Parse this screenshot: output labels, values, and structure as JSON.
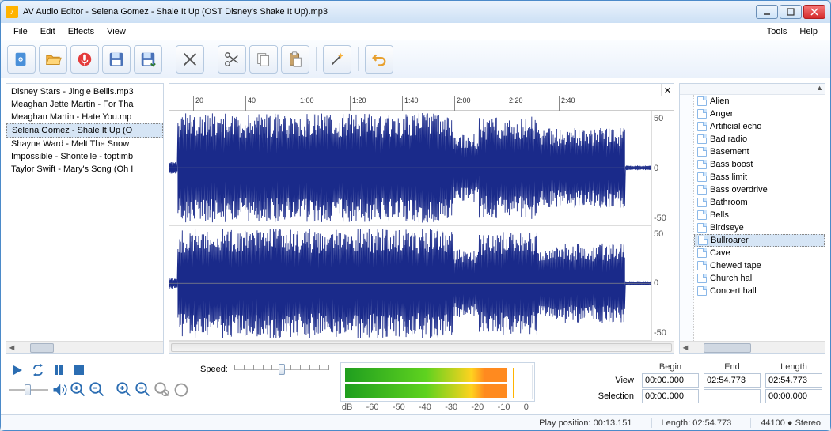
{
  "title": "AV Audio Editor - Selena Gomez - Shale It Up (OST Disney's Shake It Up).mp3",
  "menu": {
    "file": "File",
    "edit": "Edit",
    "effects": "Effects",
    "view": "View",
    "tools": "Tools",
    "help": "Help"
  },
  "toolbar_icons": [
    "new-file",
    "open-folder",
    "record",
    "save",
    "save-as",
    "cut",
    "scissors",
    "copy",
    "paste",
    "wand",
    "undo"
  ],
  "playlist": {
    "items": [
      "Disney Stars - Jingle Bellls.mp3",
      "Meaghan Jette Martin - For Tha",
      "Meaghan Martin - Hate You.mp",
      "Selena Gomez - Shale It Up (O",
      "Shayne Ward - Melt The Snow",
      "Impossible - Shontelle - toptimb",
      "Taylor Swift - Mary's Song (Oh I"
    ],
    "selected_index": 3
  },
  "timeline_ticks": [
    "20",
    "40",
    "1:00",
    "1:20",
    "1:40",
    "2:00",
    "2:20",
    "2:40"
  ],
  "yscale": [
    "50",
    "0",
    "-50"
  ],
  "effects": {
    "items": [
      "Alien",
      "Anger",
      "Artificial echo",
      "Bad radio",
      "Basement",
      "Bass boost",
      "Bass limit",
      "Bass overdrive",
      "Bathroom",
      "Bells",
      "Birdseye",
      "Bullroarer",
      "Cave",
      "Chewed tape",
      "Church hall",
      "Concert hall"
    ],
    "selected_index": 11
  },
  "transport": {
    "speed_label": "Speed:"
  },
  "meter_scale": [
    "dB",
    "-60",
    "-50",
    "-40",
    "-30",
    "-20",
    "-10",
    "0"
  ],
  "ranges": {
    "headers": {
      "begin": "Begin",
      "end": "End",
      "length": "Length"
    },
    "view_label": "View",
    "selection_label": "Selection",
    "view": {
      "begin": "00:00.000",
      "end": "02:54.773",
      "length": "02:54.773"
    },
    "selection": {
      "begin": "00:00.000",
      "end": "",
      "length": "00:00.000"
    }
  },
  "status": {
    "play_position": "Play position: 00:13.151",
    "length": "Length: 02:54.773",
    "format": "44100 ● Stereo"
  }
}
